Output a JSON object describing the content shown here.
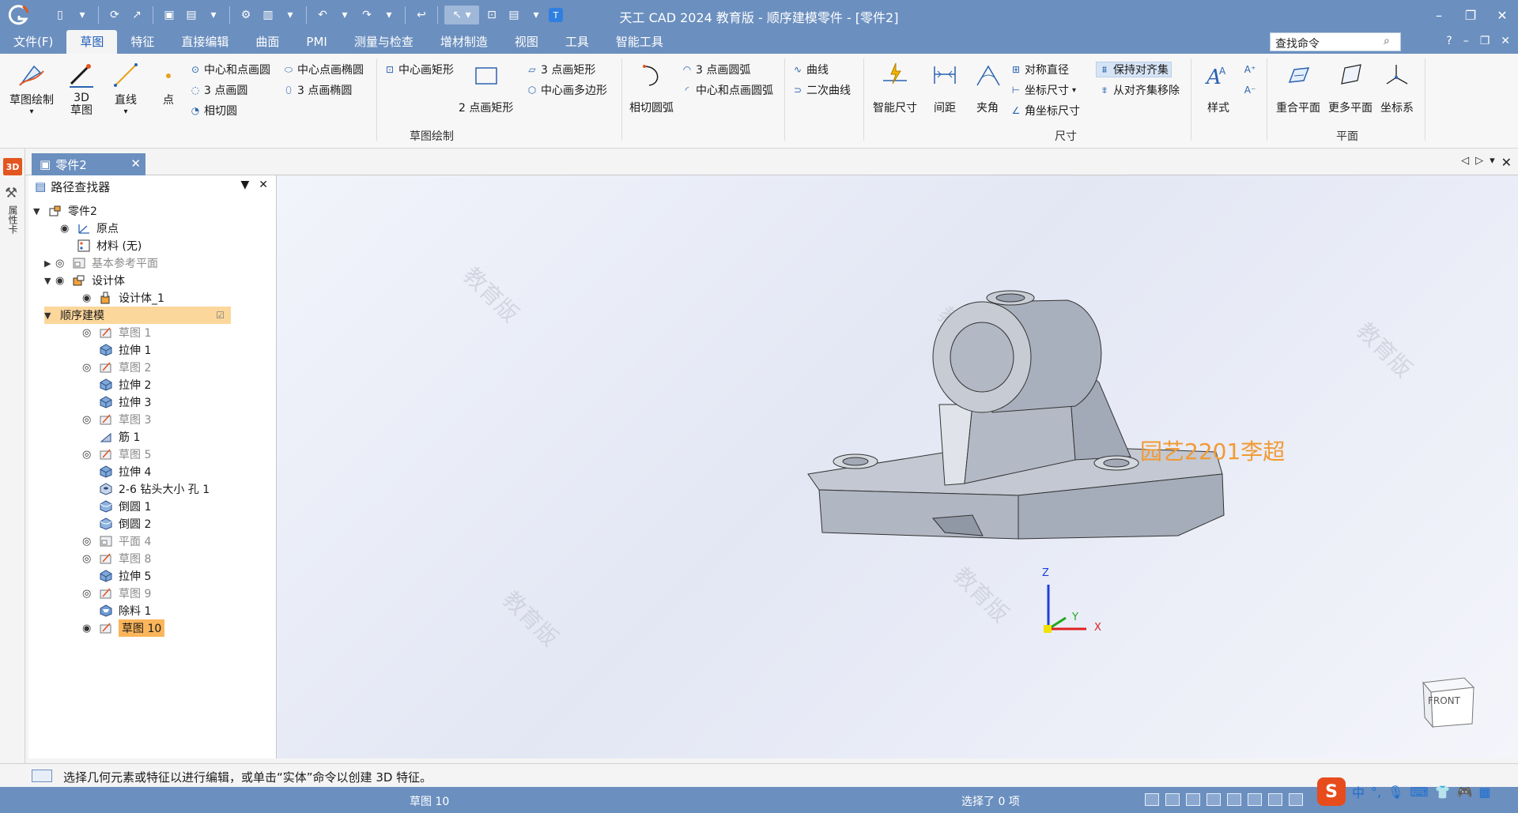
{
  "app": {
    "title": "天工 CAD 2024 教育版 - 顺序建模零件 - [零件2]",
    "colors": {
      "chrome": "#6b8fbf",
      "accent": "#1f5fb8",
      "selected": "#fbb55a",
      "band": "#fcd79b",
      "user_tag": "#f19a34"
    }
  },
  "menu": {
    "items": [
      "文件(F)",
      "草图",
      "特征",
      "直接编辑",
      "曲面",
      "PMI",
      "测量与检查",
      "增材制造",
      "视图",
      "工具",
      "智能工具"
    ],
    "active_index": 1,
    "search_value": "查找命令",
    "help": "?"
  },
  "ribbon": {
    "sketch_draw": "草图绘制",
    "sketch_3d_l1": "3D",
    "sketch_3d_l2": "草图",
    "line": "直线",
    "point": "点",
    "center_point_circle": "中心和点画圆",
    "three_point_circle": "3 点画圆",
    "tangent_circle": "相切圆",
    "center_point_ellipse": "中心点画椭圆",
    "three_point_ellipse": "3 点画椭圆",
    "center_rect": "中心画矩形",
    "two_point_rect": "2 点画矩形",
    "three_point_rect": "3 点画矩形",
    "center_polygon": "中心画多边形",
    "tangent_arc": "相切圆弧",
    "three_point_arc": "3 点画圆弧",
    "center_point_arc": "中心和点画圆弧",
    "curve": "曲线",
    "conic": "二次曲线",
    "group_sketch": "草图绘制",
    "smart_dim": "智能尺寸",
    "spacing": "间距",
    "angle": "夹角",
    "sym_dia": "对称直径",
    "coord_dim": "坐标尺寸",
    "angle_coord_dim": "角坐标尺寸",
    "keep_align": "保持对齐集",
    "remove_align": "从对齐集移除",
    "group_dim": "尺寸",
    "style": "样式",
    "coincident_plane": "重合平面",
    "more_planes": "更多平面",
    "coord_sys": "坐标系",
    "group_plane": "平面"
  },
  "doc_tab": {
    "label": "零件2"
  },
  "finder": {
    "title": "路径查找器",
    "rows": [
      {
        "label": "零件2"
      },
      {
        "label": "原点"
      },
      {
        "label": "材料 (无)"
      },
      {
        "label": "基本参考平面"
      },
      {
        "label": "设计体"
      },
      {
        "label": "设计体_1"
      },
      {
        "label": "顺序建模"
      },
      {
        "label": "草图 1"
      },
      {
        "label": "拉伸 1"
      },
      {
        "label": "草图 2"
      },
      {
        "label": "拉伸 2"
      },
      {
        "label": "拉伸 3"
      },
      {
        "label": "草图 3"
      },
      {
        "label": "筋 1"
      },
      {
        "label": "草图 5"
      },
      {
        "label": "拉伸 4"
      },
      {
        "label": "2-6 钻头大小 孔 1"
      },
      {
        "label": "倒圆 1"
      },
      {
        "label": "倒圆 2"
      },
      {
        "label": "平面 4"
      },
      {
        "label": "草图 8"
      },
      {
        "label": "拉伸 5"
      },
      {
        "label": "草图 9"
      },
      {
        "label": "除料 1"
      },
      {
        "label": "草图 10"
      }
    ]
  },
  "viewport": {
    "watermark": "教育版",
    "user_tag": "园艺2201李超",
    "axis_x": "X",
    "axis_y": "Y",
    "axis_z": "Z",
    "view_cube": "FRONT"
  },
  "status": {
    "prompt": "选择几何元素或特征以进行编辑，或单击“实体”命令以创建 3D 特征。",
    "active": "草图 10",
    "selection": "选择了 0 项",
    "ime_lang": "中"
  }
}
